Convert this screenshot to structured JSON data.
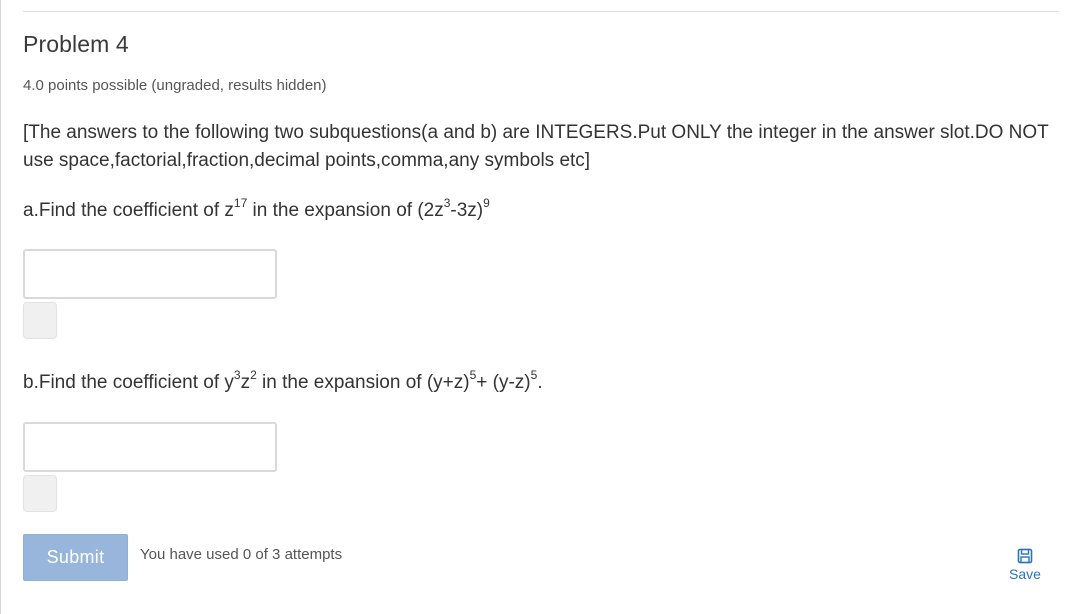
{
  "problem": {
    "title": "Problem 4",
    "points_info": "4.0 points possible (ungraded, results hidden)",
    "instructions": "[The answers to the following two subquestions(a and b) are INTEGERS.Put ONLY the integer in the answer slot.DO NOT use space,factorial,fraction,decimal points,comma,any symbols etc]"
  },
  "question_a": {
    "prefix": "a.Find the coefficient of z",
    "sup1": "17",
    "mid": " in the expansion of (2z",
    "sup2": "3",
    "mid2": "-3z)",
    "sup3": "9",
    "suffix": "",
    "answer_value": "",
    "answer_placeholder": ""
  },
  "question_b": {
    "prefix": "b.Find the coefficient of y",
    "sup1": "3",
    "mid": "z",
    "sup2": "2",
    "mid2": " in the expansion of (y+z)",
    "sup3": "5",
    "mid3": "+ (y-z)",
    "sup4": "5",
    "suffix": ".",
    "answer_value": "",
    "answer_placeholder": ""
  },
  "actions": {
    "submit_label": "Submit",
    "attempts_text": "You have used 0 of 3 attempts",
    "save_label": "Save"
  },
  "colors": {
    "submit_bg": "#98b6dc",
    "link_blue": "#2a73b8",
    "text": "#333333"
  },
  "icons": {
    "save": "floppy-disk-icon"
  }
}
